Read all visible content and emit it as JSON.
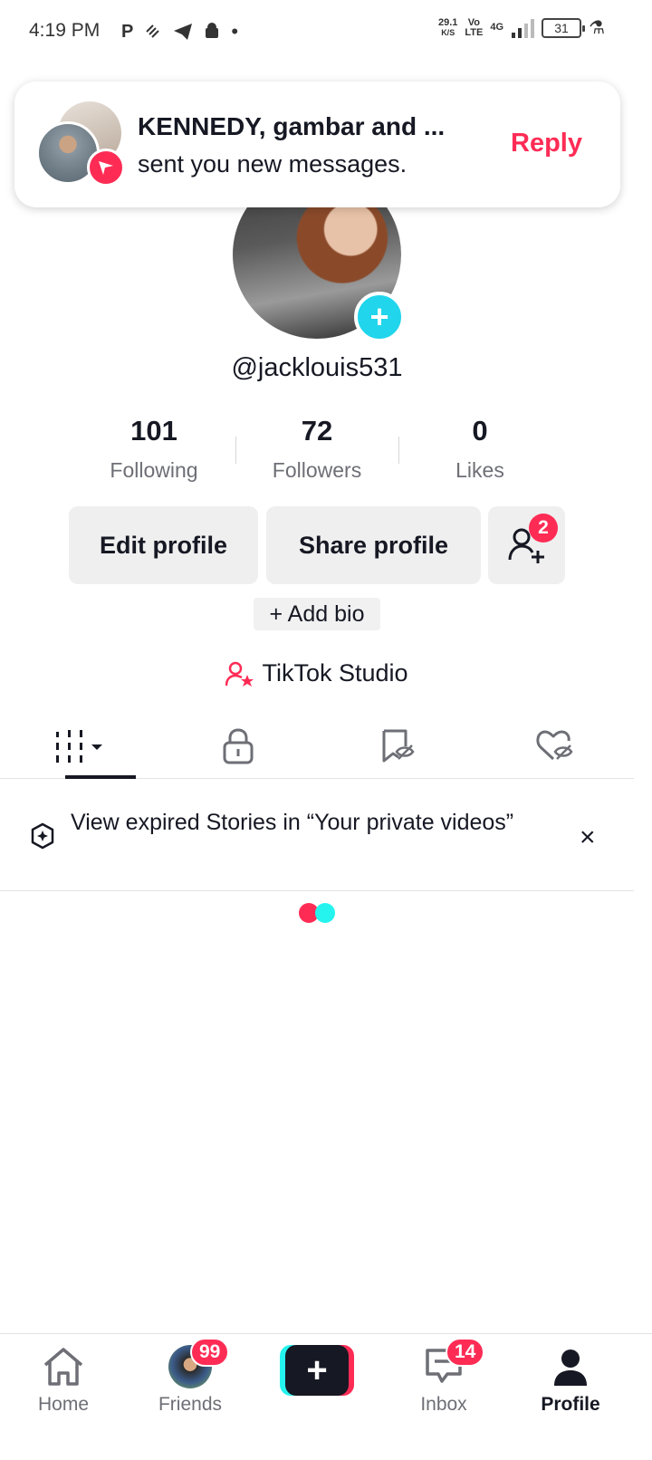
{
  "status_bar": {
    "time": "4:19 PM",
    "left_icons": [
      "p-icon",
      "satellite-icon",
      "telegram-icon",
      "android-icon",
      "dot-icon"
    ],
    "speed_value": "29.1",
    "speed_unit": "K/S",
    "network_vo": "Vo",
    "network_lte": "LTE",
    "network_4g": "4G",
    "battery": "31"
  },
  "notification": {
    "title": "KENNEDY, gambar and ...",
    "body": "sent you new messages.",
    "reply_label": "Reply"
  },
  "profile": {
    "username": "@jacklouis531",
    "stats": [
      {
        "value": "101",
        "label": "Following"
      },
      {
        "value": "72",
        "label": "Followers"
      },
      {
        "value": "0",
        "label": "Likes"
      }
    ],
    "edit_label": "Edit profile",
    "share_label": "Share profile",
    "friend_requests_badge": "2",
    "add_bio_label": "+ Add bio",
    "studio_label": "TikTok Studio"
  },
  "tabs": [
    {
      "name": "videos-grid",
      "icon": "grid-icon",
      "active": true
    },
    {
      "name": "private",
      "icon": "lock-icon",
      "active": false
    },
    {
      "name": "reposts",
      "icon": "hidden-bookmark-icon",
      "active": false
    },
    {
      "name": "liked",
      "icon": "hidden-heart-icon",
      "active": false
    }
  ],
  "expired_banner": {
    "text": "View expired Stories in “Your private videos”",
    "close": "×"
  },
  "bottom_nav": {
    "home": "Home",
    "friends": "Friends",
    "friends_badge": "99",
    "create": "+",
    "inbox": "Inbox",
    "inbox_badge": "14",
    "profile": "Profile"
  },
  "colors": {
    "accent_red": "#fe2c55",
    "accent_cyan": "#25f4ee",
    "text": "#161823"
  }
}
